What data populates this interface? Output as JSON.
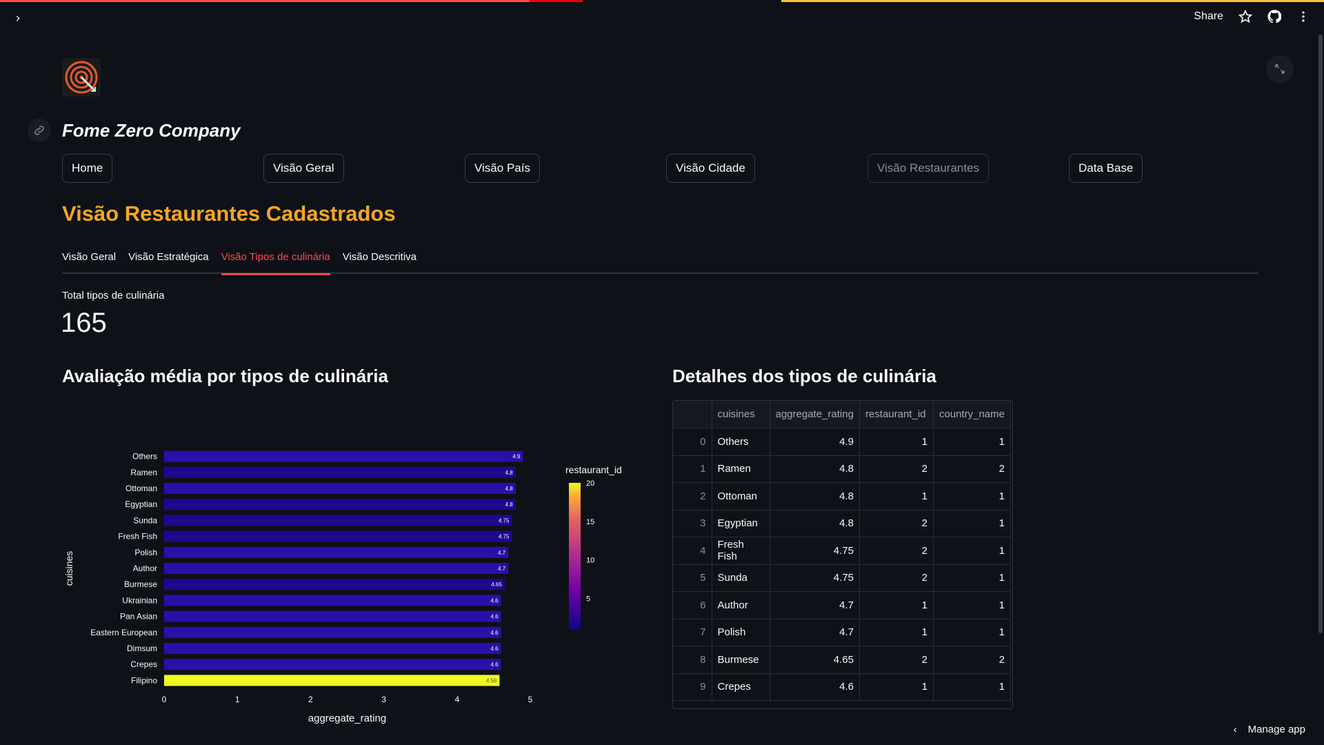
{
  "header": {
    "share_label": "Share"
  },
  "company_name": "Fome Zero Company",
  "nav": [
    {
      "label": "Home",
      "disabled": false
    },
    {
      "label": "Visão Geral",
      "disabled": false
    },
    {
      "label": "Visão País",
      "disabled": false
    },
    {
      "label": "Visão Cidade",
      "disabled": false
    },
    {
      "label": "Visão Restaurantes",
      "disabled": true
    },
    {
      "label": "Data Base",
      "disabled": false
    }
  ],
  "page_title": "Visão Restaurantes Cadastrados",
  "tabs": [
    {
      "label": "Visão Geral",
      "active": false
    },
    {
      "label": "Visão Estratégica",
      "active": false
    },
    {
      "label": "Visão Tipos de culinária",
      "active": true
    },
    {
      "label": "Visão Descritiva",
      "active": false
    }
  ],
  "metric": {
    "label": "Total tipos de culinária",
    "value": "165"
  },
  "chart_title": "Avaliação média por tipos de culinária",
  "table_title": "Detalhes dos tipos de culinária",
  "chart_data": {
    "type": "bar",
    "orientation": "horizontal",
    "categories": [
      "Others",
      "Ramen",
      "Ottoman",
      "Egyptian",
      "Sunda",
      "Fresh Fish",
      "Polish",
      "Author",
      "Burmese",
      "Ukrainian",
      "Pan Asian",
      "Eastern European",
      "Dimsum",
      "Crepes",
      "Filipino"
    ],
    "values": [
      4.9,
      4.8,
      4.8,
      4.8,
      4.75,
      4.75,
      4.7,
      4.7,
      4.65,
      4.6,
      4.6,
      4.6,
      4.6,
      4.6,
      4.58
    ],
    "value_labels": [
      "4.9",
      "4.8",
      "4.8",
      "4.8",
      "4.75",
      "4.75",
      "4.7",
      "4.7",
      "4.65",
      "4.6",
      "4.6",
      "4.6",
      "4.6",
      "4.6",
      "4.58"
    ],
    "color_values": [
      1,
      2,
      1,
      2,
      2,
      2,
      1,
      1,
      2,
      1,
      1,
      1,
      1,
      1,
      20
    ],
    "xlabel": "aggregate_rating",
    "ylabel": "cuisines",
    "xlim": [
      0,
      5
    ],
    "xticks": [
      "0",
      "1",
      "2",
      "3",
      "4",
      "5"
    ],
    "colorbar": {
      "title": "restaurant_id",
      "ticks": [
        "20",
        "15",
        "10",
        "5"
      ],
      "range": [
        1,
        20
      ]
    },
    "grid": false
  },
  "table": {
    "columns": [
      "",
      "cuisines",
      "aggregate_rating",
      "restaurant_id",
      "country_name"
    ],
    "rows": [
      [
        "0",
        "Others",
        "4.9",
        "1",
        "1"
      ],
      [
        "1",
        "Ramen",
        "4.8",
        "2",
        "2"
      ],
      [
        "2",
        "Ottoman",
        "4.8",
        "1",
        "1"
      ],
      [
        "3",
        "Egyptian",
        "4.8",
        "2",
        "1"
      ],
      [
        "4",
        "Fresh Fish",
        "4.75",
        "2",
        "1"
      ],
      [
        "5",
        "Sunda",
        "4.75",
        "2",
        "1"
      ],
      [
        "6",
        "Author",
        "4.7",
        "1",
        "1"
      ],
      [
        "7",
        "Polish",
        "4.7",
        "1",
        "1"
      ],
      [
        "8",
        "Burmese",
        "4.65",
        "2",
        "2"
      ],
      [
        "9",
        "Crepes",
        "4.6",
        "1",
        "1"
      ]
    ]
  },
  "footer": {
    "manage_label": "Manage app"
  }
}
